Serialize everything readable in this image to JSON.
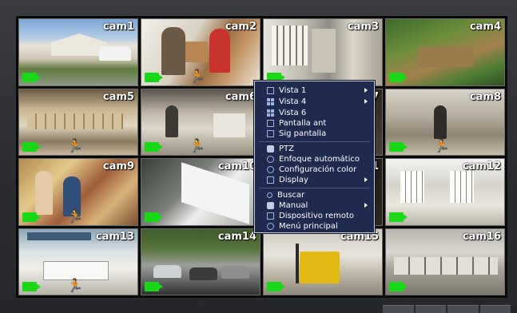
{
  "cameras": [
    {
      "label": "cam1",
      "motion": false
    },
    {
      "label": "cam2",
      "motion": true
    },
    {
      "label": "cam3",
      "motion": false
    },
    {
      "label": "cam4",
      "motion": false
    },
    {
      "label": "cam5",
      "motion": true
    },
    {
      "label": "cam6",
      "motion": true
    },
    {
      "label": "cam7",
      "motion": false
    },
    {
      "label": "cam8",
      "motion": true
    },
    {
      "label": "cam9",
      "motion": true
    },
    {
      "label": "cam10",
      "motion": false
    },
    {
      "label": "cam11",
      "motion": false
    },
    {
      "label": "cam12",
      "motion": false
    },
    {
      "label": "cam13",
      "motion": true
    },
    {
      "label": "cam14",
      "motion": false
    },
    {
      "label": "cam15",
      "motion": false
    },
    {
      "label": "cam16",
      "motion": false
    }
  ],
  "context_menu": {
    "items": [
      {
        "label": "Vista 1",
        "icon": "single-view-icon",
        "submenu": true
      },
      {
        "label": "Vista 4",
        "icon": "quad-view-icon",
        "submenu": true
      },
      {
        "label": "Vista 6",
        "icon": "six-view-icon",
        "submenu": false
      },
      {
        "label": "Pantalla ant",
        "icon": "previous-screen-icon",
        "submenu": false
      },
      {
        "label": "Sig pantalla",
        "icon": "next-screen-icon",
        "submenu": false
      },
      {
        "label": "PTZ",
        "icon": "ptz-camera-icon",
        "submenu": false
      },
      {
        "label": "Enfoque automático",
        "icon": "autofocus-icon",
        "submenu": false
      },
      {
        "label": "Configuración color",
        "icon": "color-settings-icon",
        "submenu": false
      },
      {
        "label": "Display",
        "icon": "display-icon",
        "submenu": true
      },
      {
        "label": "Buscar",
        "icon": "search-icon",
        "submenu": false
      },
      {
        "label": "Manual",
        "icon": "manual-record-icon",
        "submenu": true
      },
      {
        "label": "Dispositivo remoto",
        "icon": "remote-device-icon",
        "submenu": false
      },
      {
        "label": "Menú principal",
        "icon": "main-menu-icon",
        "submenu": false
      }
    ]
  },
  "colors": {
    "menu_bg": "#1e2a4e",
    "record_indicator": "#18d818",
    "motion_indicator": "#ff1f1f"
  }
}
